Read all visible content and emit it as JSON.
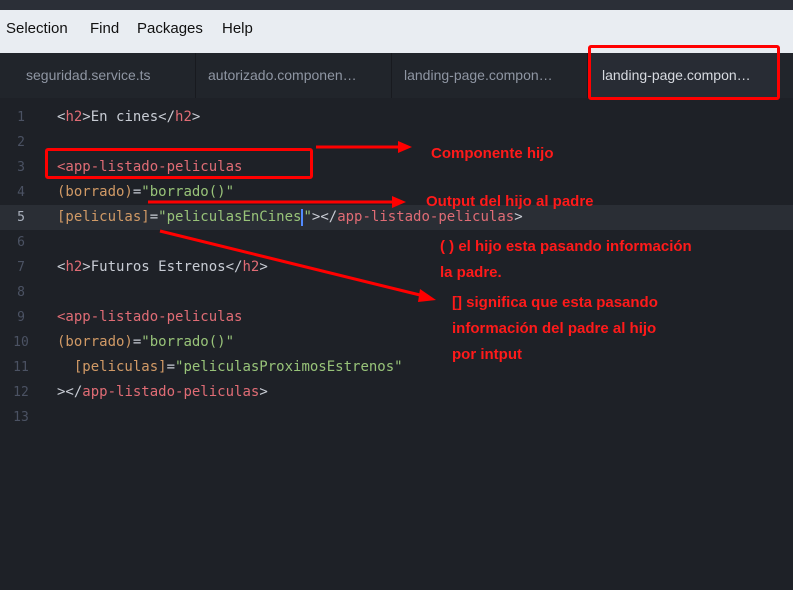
{
  "menu": {
    "items": [
      "Selection",
      "Find",
      "Packages",
      "Help"
    ]
  },
  "tabs": [
    {
      "label": "seguridad.service.ts",
      "active": false
    },
    {
      "label": "autorizado.componen…",
      "active": false
    },
    {
      "label": "landing-page.compon…",
      "active": false
    },
    {
      "label": "landing-page.compon…",
      "active": true
    }
  ],
  "editor": {
    "current_line": 5,
    "lines": [
      {
        "num": "1",
        "code": "<h2>En cines</h2>"
      },
      {
        "num": "2",
        "code": ""
      },
      {
        "num": "3",
        "code": "<app-listado-peliculas"
      },
      {
        "num": "4",
        "code": "(borrado)=\"borrado()\""
      },
      {
        "num": "5",
        "code": "[peliculas]=\"peliculasEnCines\"></app-listado-peliculas>"
      },
      {
        "num": "6",
        "code": ""
      },
      {
        "num": "7",
        "code": "<h2>Futuros Estrenos</h2>"
      },
      {
        "num": "8",
        "code": ""
      },
      {
        "num": "9",
        "code": "<app-listado-peliculas"
      },
      {
        "num": "10",
        "code": "(borrado)=\"borrado()\""
      },
      {
        "num": "11",
        "code": "  [peliculas]=\"peliculasProximosEstrenos\""
      },
      {
        "num": "12",
        "code": "></app-listado-peliculas>"
      },
      {
        "num": "13",
        "code": ""
      }
    ]
  },
  "annotations": {
    "componente_hijo": "Componente hijo",
    "output": "Output del hijo al padre",
    "parentheses_line1": "( ) el hijo esta pasando información",
    "parentheses_line2": "la padre.",
    "brackets_line1": "[] significa que esta pasando",
    "brackets_line2": "información del padre al hijo",
    "brackets_line3": "por intput"
  },
  "colors": {
    "annotation": "#ff0000",
    "tag": "#e06c75",
    "attribute": "#d19a66",
    "string": "#98c379"
  }
}
